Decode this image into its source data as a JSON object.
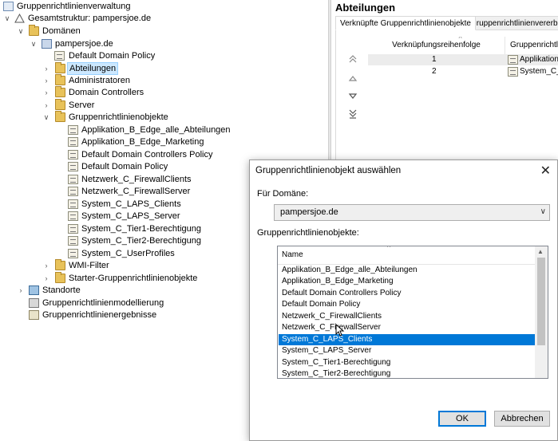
{
  "tree": {
    "root_label": "Gruppenrichtlinienverwaltung",
    "forest_label": "Gesamtstruktur: pampersjoe.de",
    "domains_label": "Domänen",
    "domain_label": "pampersjoe.de",
    "domain_children": [
      {
        "label": "Default Domain Policy",
        "type": "gpo",
        "expandable": false
      },
      {
        "label": "Abteilungen",
        "type": "folder",
        "expandable": true,
        "selected": true
      },
      {
        "label": "Administratoren",
        "type": "folder",
        "expandable": true
      },
      {
        "label": "Domain Controllers",
        "type": "folder",
        "expandable": true
      },
      {
        "label": "Server",
        "type": "folder",
        "expandable": true
      }
    ],
    "gpo_container_label": "Gruppenrichtlinienobjekte",
    "gpos": [
      "Applikation_B_Edge_alle_Abteilungen",
      "Applikation_B_Edge_Marketing",
      "Default Domain Controllers Policy",
      "Default Domain Policy",
      "Netzwerk_C_FirewallClients",
      "Netzwerk_C_FirewallServer",
      "System_C_LAPS_Clients",
      "System_C_LAPS_Server",
      "System_C_Tier1-Berechtigung",
      "System_C_Tier2-Berechtigung",
      "System_C_UserProfiles"
    ],
    "wmi_label": "WMI-Filter",
    "starter_label": "Starter-Gruppenrichtlinienobjekte",
    "sites_label": "Standorte",
    "modeling_label": "Gruppenrichtlinienmodellierung",
    "results_label": "Gruppenrichtlinienergebnisse"
  },
  "detail": {
    "title": "Abteilungen",
    "tabs": [
      "Verknüpfte Gruppenrichtlinienobjekte",
      "Gruppenrichtlinienvererbung"
    ],
    "columns": [
      "Verknüpfungsreihenfolge",
      "Gruppenrichtl"
    ],
    "rows": [
      {
        "order": "1",
        "name": "Applikation_"
      },
      {
        "order": "2",
        "name": "System_C_T"
      }
    ],
    "move_icons": [
      "move-top-icon",
      "move-up-icon",
      "move-down-icon",
      "move-bottom-icon"
    ]
  },
  "dialog": {
    "title": "Gruppenrichtlinienobjekt auswählen",
    "close_glyph": "✕",
    "domain_label": "Für Domäne:",
    "domain_value": "pampersjoe.de",
    "list_label": "Gruppenrichtlinienobjekte:",
    "list_header": "Name",
    "items": [
      "Applikation_B_Edge_alle_Abteilungen",
      "Applikation_B_Edge_Marketing",
      "Default Domain Controllers Policy",
      "Default Domain Policy",
      "Netzwerk_C_FirewallClients",
      "Netzwerk_C_FirewallServer",
      "System_C_LAPS_Clients",
      "System_C_LAPS_Server",
      "System_C_Tier1-Berechtigung",
      "System_C_Tier2-Berechtigung"
    ],
    "selected_item": "System_C_LAPS_Clients",
    "ok_label": "OK",
    "cancel_label": "Abbrechen"
  },
  "colors": {
    "selection_blue": "#0078d7",
    "tree_selection": "#cce8ff",
    "folder": "#e8c25a"
  }
}
